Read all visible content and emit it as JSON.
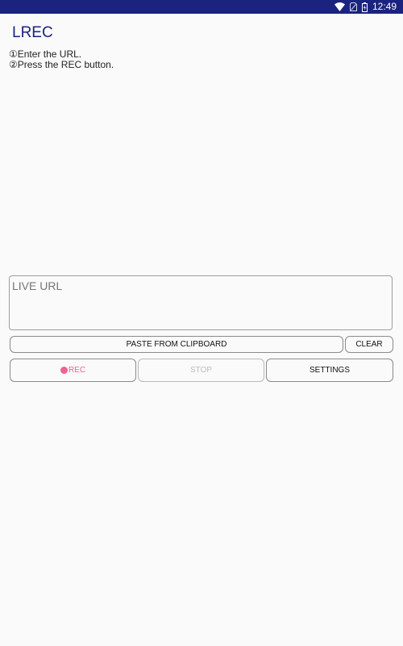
{
  "status_bar": {
    "time": "12:49",
    "icons": [
      "wifi-icon",
      "sim-icon",
      "battery-icon"
    ]
  },
  "app": {
    "title": "LREC",
    "accent_color": "#1a237e"
  },
  "instructions": {
    "step1": "①Enter the URL.",
    "step2": "②Press the REC button."
  },
  "url_field": {
    "placeholder": "LIVE URL",
    "value": ""
  },
  "buttons": {
    "paste": "PASTE FROM CLIPBOARD",
    "clear": "CLEAR",
    "rec": "REC",
    "rec_color": "#f06292",
    "stop": "STOP",
    "settings": "SETTINGS"
  }
}
